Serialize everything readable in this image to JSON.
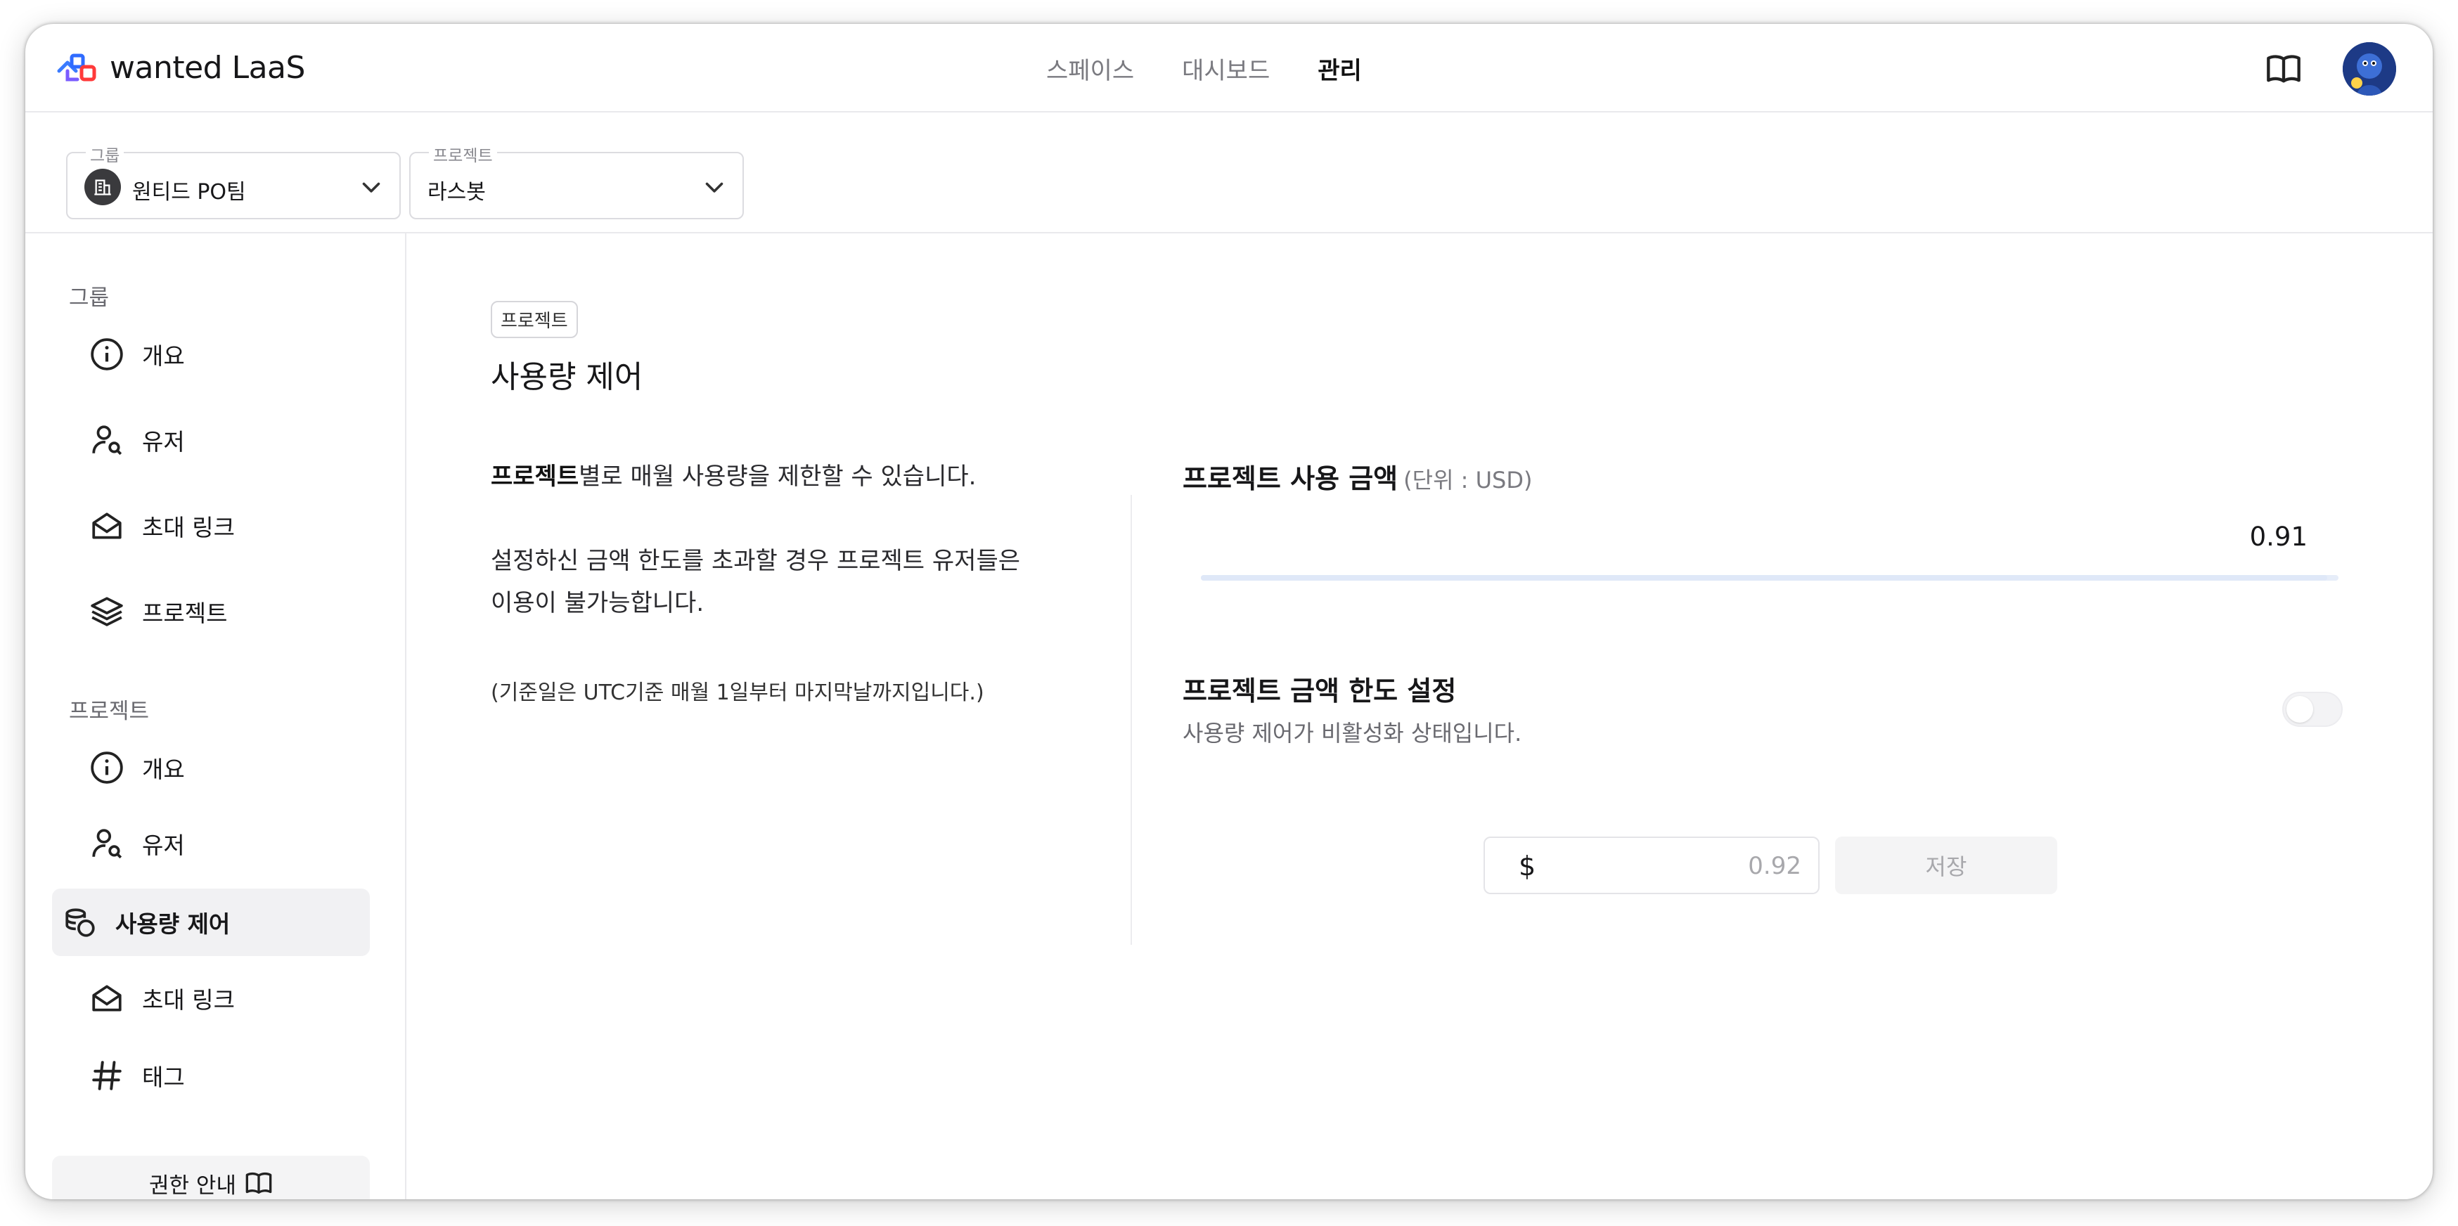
{
  "app": {
    "logo_text": "wanted LaaS"
  },
  "nav": {
    "items": [
      {
        "label": "스페이스"
      },
      {
        "label": "대시보드"
      },
      {
        "label": "관리"
      }
    ]
  },
  "selectors": {
    "group": {
      "legend": "그룹",
      "value": "원티드 PO팀"
    },
    "project": {
      "legend": "프로젝트",
      "value": "라스봇"
    }
  },
  "sidebar": {
    "group_section": "그룹",
    "group_items": [
      {
        "label": "개요",
        "icon": "info-icon"
      },
      {
        "label": "유저",
        "icon": "user-search-icon"
      },
      {
        "label": "초대 링크",
        "icon": "mail-open-icon"
      },
      {
        "label": "프로젝트",
        "icon": "layers-icon"
      }
    ],
    "project_section": "프로젝트",
    "project_items": [
      {
        "label": "개요",
        "icon": "info-icon"
      },
      {
        "label": "유저",
        "icon": "user-search-icon"
      },
      {
        "label": "사용량 제어",
        "icon": "coins-icon",
        "active": true
      },
      {
        "label": "초대 링크",
        "icon": "mail-open-icon"
      },
      {
        "label": "태그",
        "icon": "hash-icon"
      }
    ],
    "permission_button": "권한 안내"
  },
  "main": {
    "chip": "프로젝트",
    "title": "사용량 제어",
    "desc_bold": "프로젝트",
    "desc_line1_rest": "별로 매월 사용량을 제한할 수 있습니다.",
    "desc_line2": "설정하신 금액 한도를 초과할 경우 프로젝트 유저들은",
    "desc_line3": "이용이 불가능합니다.",
    "note": "(기준일은 UTC기준 매월 1일부터 마지막날까지입니다.)",
    "usage": {
      "title": "프로젝트 사용 금액",
      "unit": "(단위 : USD)",
      "value": "0.91",
      "fill_percent": 99
    },
    "limit": {
      "title": "프로젝트 금액 한도 설정",
      "subtitle": "사용량 제어가 비활성화 상태입니다.",
      "enabled": false,
      "currency": "$",
      "placeholder": "0.92",
      "save_label": "저장"
    }
  },
  "colors": {
    "accent_blue": "#3366ff",
    "active_bg": "#f1f1f3"
  }
}
